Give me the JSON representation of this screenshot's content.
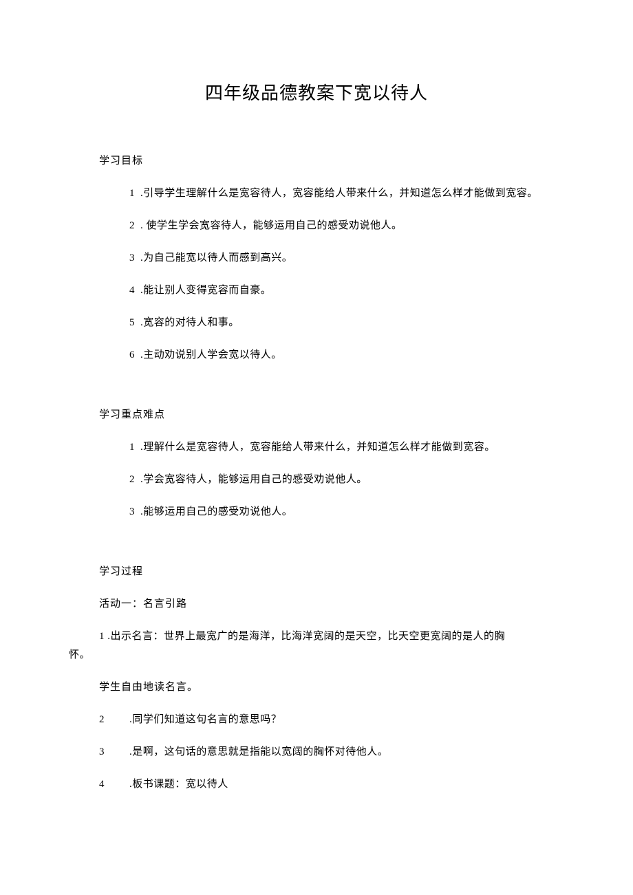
{
  "title": "四年级品德教案下宽以待人",
  "section1": {
    "header": "学习目标",
    "items": [
      {
        "num": "1",
        "text": ".引导学生理解什么是宽容待人，宽容能给人带来什么，并知道怎么样才能做到宽容。"
      },
      {
        "num": "2",
        "text": ". 使学生学会宽容待人，能够运用自己的感受劝说他人。"
      },
      {
        "num": "3",
        "text": ".为自己能宽以待人而感到高兴。"
      },
      {
        "num": "4",
        "text": ".能让别人变得宽容而自豪。"
      },
      {
        "num": "5",
        "text": ".宽容的对待人和事。"
      },
      {
        "num": "6",
        "text": ".主动劝说别人学会宽以待人。"
      }
    ]
  },
  "section2": {
    "header": "学习重点难点",
    "items": [
      {
        "num": "1",
        "text": ".理解什么是宽容待人，宽容能给人带来什么，并知道怎么样才能做到宽容。"
      },
      {
        "num": "2",
        "text": ".学会宽容待人，能够运用自己的感受劝说他人。"
      },
      {
        "num": "3",
        "text": ".能够运用自己的感受劝说他人。"
      }
    ]
  },
  "section3": {
    "header": "学习过程",
    "subheader": "活动一：名言引路",
    "item1_line1": "1   .出示名言：世界上最宽广的是海洋，比海洋宽阔的是天空，比天空更宽阔的是人的胸",
    "item1_line2": "怀。",
    "plain1": "学生自由地读名言。",
    "wide_items": [
      {
        "num": "2",
        "text": ".同学们知道这句名言的意思吗？"
      },
      {
        "num": "3",
        "text": ".是啊，这句话的意思就是指能以宽阔的胸怀对待他人。"
      },
      {
        "num": "4",
        "text": ".板书课题：宽以待人"
      }
    ]
  }
}
